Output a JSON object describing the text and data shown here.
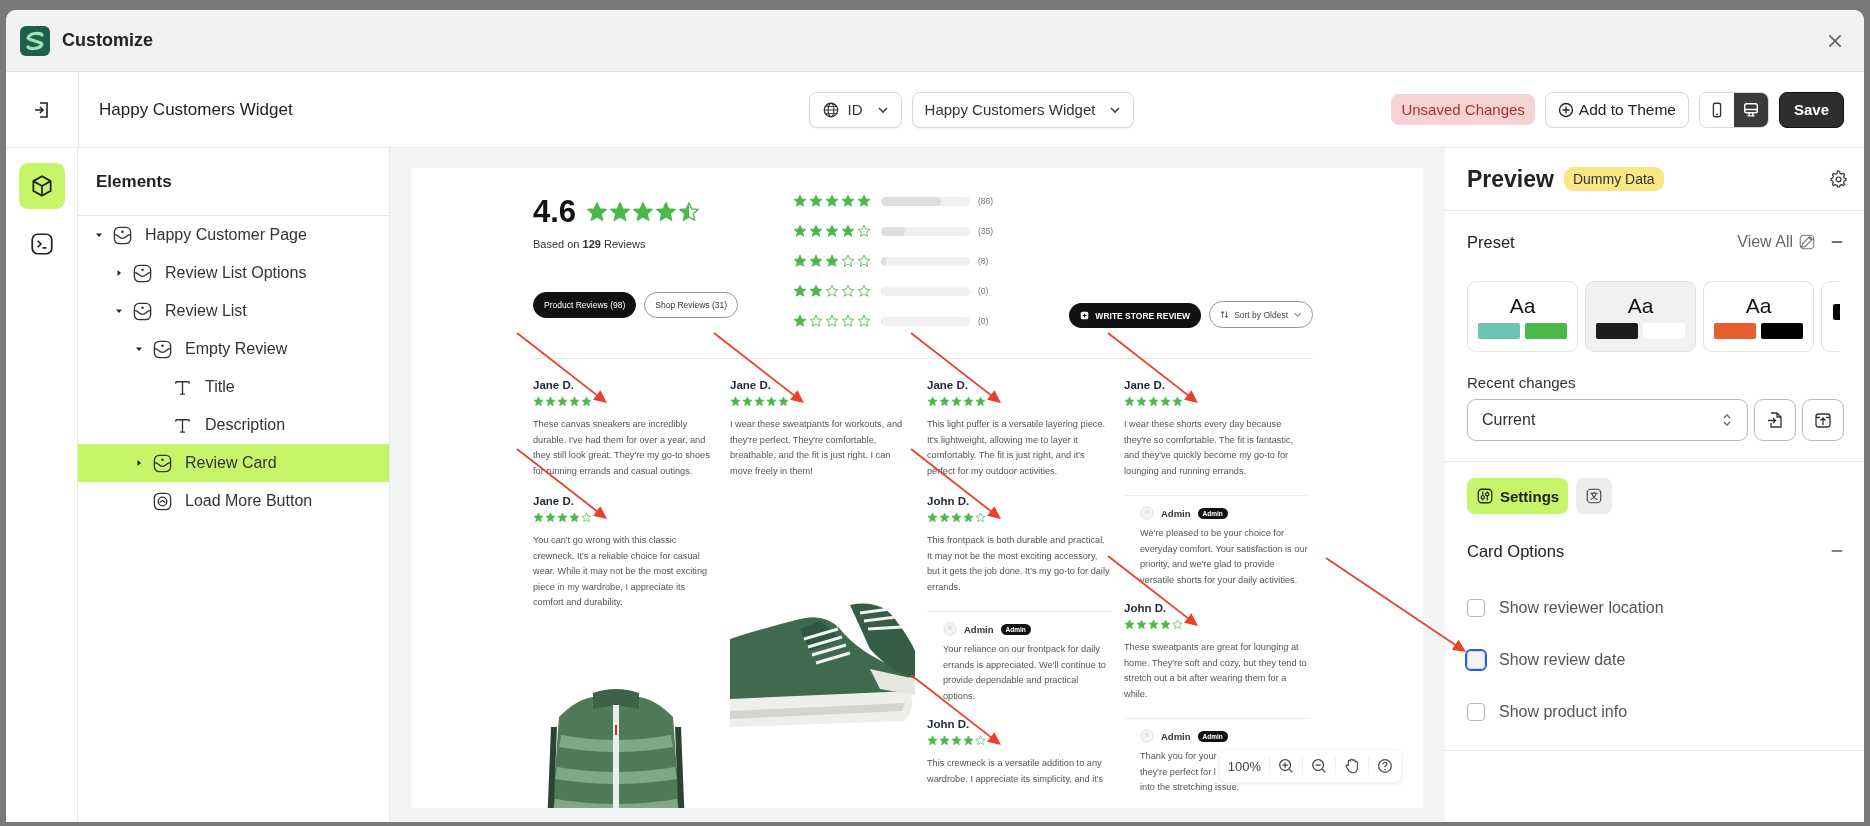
{
  "window": {
    "title": "Customize"
  },
  "toolbar": {
    "title": "Happy Customers Widget",
    "language": "ID",
    "widget": "Happy Customers Widget",
    "status_badge": "Unsaved Changes",
    "add_button": "Add to Theme",
    "save_button": "Save",
    "devices": [
      {
        "kind": "mobile",
        "selected": false
      },
      {
        "kind": "desktop",
        "selected": true
      }
    ]
  },
  "rail": [
    {
      "kind": "elements",
      "selected": true
    },
    {
      "kind": "code",
      "selected": false
    }
  ],
  "elements_panel": {
    "title": "Elements",
    "tree": [
      {
        "label": "Happy Customer Page",
        "kind": "block",
        "expanded": true,
        "selected": false,
        "children": [
          {
            "label": "Review List Options",
            "kind": "block",
            "expanded": false,
            "selected": false
          },
          {
            "label": "Review List",
            "kind": "block",
            "expanded": true,
            "selected": false,
            "children": [
              {
                "label": "Empty Review",
                "kind": "block",
                "expanded": true,
                "selected": false,
                "children": [
                  {
                    "label": "Title",
                    "kind": "text",
                    "selected": false
                  },
                  {
                    "label": "Description",
                    "kind": "text",
                    "selected": false
                  }
                ]
              },
              {
                "label": "Review Card",
                "kind": "block",
                "expanded": false,
                "selected": true
              },
              {
                "label": "Load More Button",
                "kind": "button",
                "selected": false
              }
            ]
          }
        ]
      }
    ]
  },
  "preview": {
    "summary": {
      "score": "4.6",
      "stars": 4.5,
      "based_on": "Based on **129** Reviews"
    },
    "breakdown": [
      {
        "stars": 5,
        "level": 0.67,
        "count": "(86)"
      },
      {
        "stars": 4,
        "level": 0.27,
        "count": "(35)"
      },
      {
        "stars": 3,
        "level": 0.06,
        "count": "(8)"
      },
      {
        "stars": 2,
        "level": 0,
        "count": "(0)"
      },
      {
        "stars": 1,
        "level": 0,
        "count": "(0)"
      }
    ],
    "tabs": [
      {
        "label": "Product Reviews (98)",
        "selected": true
      },
      {
        "label": "Shop Reviews (31)",
        "selected": false
      }
    ],
    "write_button": "WRITE STORE REVIEW",
    "sort": "Sort by Oldest",
    "columns": [
      [
        {
          "kind": "review",
          "name": "Jane D.",
          "stars": 5,
          "text": "These canvas sneakers are incredibly durable. I've had them for over a year, and they still look great. They're my go-to shoes for running errands and casual outings."
        },
        {
          "kind": "review",
          "name": "Jane D.",
          "stars": 4,
          "text": "You can't go wrong with this classic crewneck. It's a reliable choice for casual wear. While it may not be the most exciting piece in my wardrobe, I appreciate its comfort and durability."
        },
        {
          "kind": "picture"
        }
      ],
      [
        {
          "kind": "review",
          "name": "Jane D.",
          "stars": 5,
          "text": "I wear these sweatpants for workouts, and they're perfect. They're comfortable, breathable, and the fit is just right. I can move freely in them!"
        },
        {
          "kind": "picture"
        }
      ],
      [
        {
          "kind": "review",
          "name": "Jane D.",
          "stars": 5,
          "text": "This light puffer is a versatile layering piece. It's lightweight, allowing me to layer it comfortably. The fit is just right, and it's perfect for my outdoor activities."
        },
        {
          "kind": "review",
          "name": "John D.",
          "stars": 4,
          "text": "This frontpack is both durable and practical. It may not be the most exciting accessory, but it gets the job done. It's my go-to for daily errands."
        },
        {
          "kind": "reply",
          "name": "Admin",
          "badge": "Admin",
          "text": "Your reliance on our frontpack for daily errands is appreciated. We'll continue to provide dependable and practical options."
        },
        {
          "kind": "review",
          "name": "John D.",
          "stars": 4,
          "text": "This crewneck is a versatile addition to any wardrobe. I appreciate its simplicity, and it's"
        }
      ],
      [
        {
          "kind": "review",
          "name": "Jane D.",
          "stars": 5,
          "text": "I wear these shorts every day because they're so comfortable. The fit is fantastic, and they've quickly become my go-to for lounging and running errands."
        },
        {
          "kind": "reply",
          "name": "Admin",
          "badge": "Admin",
          "text": "We're pleased to be your choice for everyday comfort. Your satisfaction is our priority, and we're glad to provide versatile shorts for your daily activities."
        },
        {
          "kind": "review",
          "name": "John D.",
          "stars": 4,
          "text": "These sweatpants are great for lounging at home. They're soft and cozy, but they tend to stretch out a bit after wearing them for a while."
        },
        {
          "kind": "reply",
          "name": "Admin",
          "badge": "Admin",
          "lines": [
            "Thank you for your",
            "they're perfect for l",
            "into the stretching issue."
          ]
        }
      ]
    ],
    "zoom": "100%"
  },
  "right_panel": {
    "title": "Preview",
    "badge": "Dummy Data",
    "preset": {
      "title": "Preset",
      "view_all": "View All",
      "cards": [
        {
          "label": "Aa",
          "selected": false,
          "swatches": [
            {
              "color": "#6cc4b0"
            },
            {
              "color": "#4cb84c"
            }
          ]
        },
        {
          "label": "Aa",
          "selected": true,
          "swatches": [
            {
              "color": "#1c1c1c"
            },
            {
              "color": "#ffffff"
            }
          ]
        },
        {
          "label": "Aa",
          "selected": false,
          "swatches": [
            {
              "color": "#e85d2f"
            },
            {
              "color": "#000000"
            }
          ]
        },
        {
          "selected": false,
          "swatches": [
            {
              "color": "#000000"
            }
          ]
        }
      ]
    },
    "recent": {
      "label": "Recent changes",
      "value": "Current"
    },
    "tabs": [
      {
        "kind": "settings",
        "label": "Settings",
        "selected": true
      },
      {
        "kind": "translate",
        "selected": false
      }
    ],
    "card_options": {
      "title": "Card Options",
      "options": [
        {
          "label": "Show reviewer location",
          "checked": false,
          "focused": false
        },
        {
          "label": "Show review date",
          "checked": false,
          "focused": true
        },
        {
          "label": "Show product info",
          "checked": false,
          "focused": false
        }
      ]
    }
  }
}
